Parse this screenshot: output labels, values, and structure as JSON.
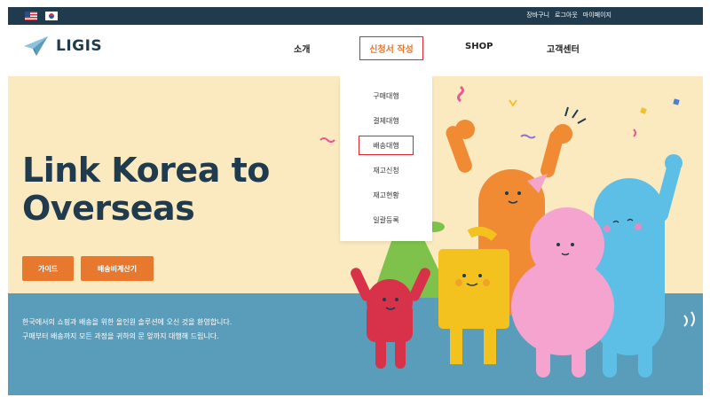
{
  "topbar": {
    "languages": [
      "English",
      "Korean"
    ],
    "links": [
      "장바구니",
      "로그아웃",
      "마이페이지"
    ]
  },
  "header": {
    "logo_text": "LIGIS",
    "nav": {
      "about": "소개",
      "apply": "신청서 작성",
      "shop": "SHOP",
      "support": "고객센터"
    }
  },
  "dropdown": {
    "items": [
      "구매대행",
      "결제대행",
      "배송대행",
      "재고신청",
      "재고현황",
      "일괄등록"
    ],
    "highlighted": "배송대행"
  },
  "hero": {
    "headline_line1": "Link Korea to",
    "headline_line2": "Overseas",
    "guide_button": "가이드",
    "calc_button": "배송비계산기",
    "desc_line1": "한국에서의 쇼핑과 배송을 위한 올인원 솔루션에 오신 것을 환영합니다.",
    "desc_line2": "구매부터 배송까지 모든 과정을 귀하의 문 앞까지 대행해 드립니다."
  },
  "colors": {
    "navy": "#1f3b4d",
    "orange": "#e8782e",
    "highlight_red": "#e0252f",
    "hero_bg": "#fbe9c0",
    "hero_blue": "#5a9dbb"
  }
}
